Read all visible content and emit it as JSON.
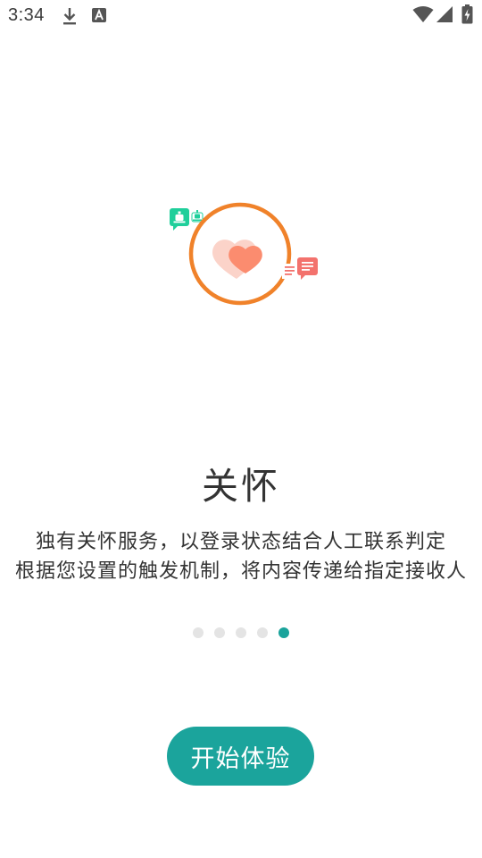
{
  "status_bar": {
    "time": "3:34",
    "icons": [
      "download-icon",
      "a-badge-icon",
      "wifi-icon",
      "cellular-signal-icon",
      "battery-charging-icon"
    ]
  },
  "illustration": {
    "icons": [
      "robot-chat-bubble-icon",
      "robot-icon",
      "heart-icon",
      "message-lines-icon",
      "chat-bubble-icon"
    ],
    "colors": {
      "ring": "#f0822a",
      "heart_back": "#fbd3c9",
      "heart_front": "#fb8c6f",
      "green": "#1fcf9b",
      "red": "#f3726d"
    }
  },
  "onboarding": {
    "title": "关怀",
    "description_line1": "独有关怀服务，以登录状态结合人工联系判定",
    "description_line2": "根据您设置的触发机制，将内容传递给指定接收人"
  },
  "pager": {
    "total": 5,
    "current": 5,
    "active_color": "#1aa39b",
    "inactive_color": "#e4e4e4"
  },
  "actions": {
    "start_label": "开始体验",
    "start_color": "#1ba49c"
  }
}
